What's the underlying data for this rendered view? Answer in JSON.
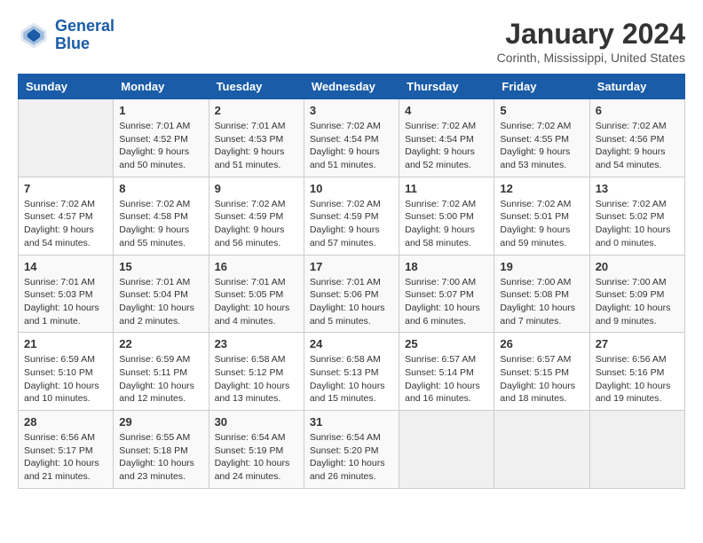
{
  "logo": {
    "line1": "General",
    "line2": "Blue"
  },
  "title": "January 2024",
  "location": "Corinth, Mississippi, United States",
  "days_of_week": [
    "Sunday",
    "Monday",
    "Tuesday",
    "Wednesday",
    "Thursday",
    "Friday",
    "Saturday"
  ],
  "weeks": [
    [
      {
        "num": "",
        "sunrise": "",
        "sunset": "",
        "daylight": "",
        "empty": true
      },
      {
        "num": "1",
        "sunrise": "Sunrise: 7:01 AM",
        "sunset": "Sunset: 4:52 PM",
        "daylight": "Daylight: 9 hours and 50 minutes."
      },
      {
        "num": "2",
        "sunrise": "Sunrise: 7:01 AM",
        "sunset": "Sunset: 4:53 PM",
        "daylight": "Daylight: 9 hours and 51 minutes."
      },
      {
        "num": "3",
        "sunrise": "Sunrise: 7:02 AM",
        "sunset": "Sunset: 4:54 PM",
        "daylight": "Daylight: 9 hours and 51 minutes."
      },
      {
        "num": "4",
        "sunrise": "Sunrise: 7:02 AM",
        "sunset": "Sunset: 4:54 PM",
        "daylight": "Daylight: 9 hours and 52 minutes."
      },
      {
        "num": "5",
        "sunrise": "Sunrise: 7:02 AM",
        "sunset": "Sunset: 4:55 PM",
        "daylight": "Daylight: 9 hours and 53 minutes."
      },
      {
        "num": "6",
        "sunrise": "Sunrise: 7:02 AM",
        "sunset": "Sunset: 4:56 PM",
        "daylight": "Daylight: 9 hours and 54 minutes."
      }
    ],
    [
      {
        "num": "7",
        "sunrise": "Sunrise: 7:02 AM",
        "sunset": "Sunset: 4:57 PM",
        "daylight": "Daylight: 9 hours and 54 minutes."
      },
      {
        "num": "8",
        "sunrise": "Sunrise: 7:02 AM",
        "sunset": "Sunset: 4:58 PM",
        "daylight": "Daylight: 9 hours and 55 minutes."
      },
      {
        "num": "9",
        "sunrise": "Sunrise: 7:02 AM",
        "sunset": "Sunset: 4:59 PM",
        "daylight": "Daylight: 9 hours and 56 minutes."
      },
      {
        "num": "10",
        "sunrise": "Sunrise: 7:02 AM",
        "sunset": "Sunset: 4:59 PM",
        "daylight": "Daylight: 9 hours and 57 minutes."
      },
      {
        "num": "11",
        "sunrise": "Sunrise: 7:02 AM",
        "sunset": "Sunset: 5:00 PM",
        "daylight": "Daylight: 9 hours and 58 minutes."
      },
      {
        "num": "12",
        "sunrise": "Sunrise: 7:02 AM",
        "sunset": "Sunset: 5:01 PM",
        "daylight": "Daylight: 9 hours and 59 minutes."
      },
      {
        "num": "13",
        "sunrise": "Sunrise: 7:02 AM",
        "sunset": "Sunset: 5:02 PM",
        "daylight": "Daylight: 10 hours and 0 minutes."
      }
    ],
    [
      {
        "num": "14",
        "sunrise": "Sunrise: 7:01 AM",
        "sunset": "Sunset: 5:03 PM",
        "daylight": "Daylight: 10 hours and 1 minute."
      },
      {
        "num": "15",
        "sunrise": "Sunrise: 7:01 AM",
        "sunset": "Sunset: 5:04 PM",
        "daylight": "Daylight: 10 hours and 2 minutes."
      },
      {
        "num": "16",
        "sunrise": "Sunrise: 7:01 AM",
        "sunset": "Sunset: 5:05 PM",
        "daylight": "Daylight: 10 hours and 4 minutes."
      },
      {
        "num": "17",
        "sunrise": "Sunrise: 7:01 AM",
        "sunset": "Sunset: 5:06 PM",
        "daylight": "Daylight: 10 hours and 5 minutes."
      },
      {
        "num": "18",
        "sunrise": "Sunrise: 7:00 AM",
        "sunset": "Sunset: 5:07 PM",
        "daylight": "Daylight: 10 hours and 6 minutes."
      },
      {
        "num": "19",
        "sunrise": "Sunrise: 7:00 AM",
        "sunset": "Sunset: 5:08 PM",
        "daylight": "Daylight: 10 hours and 7 minutes."
      },
      {
        "num": "20",
        "sunrise": "Sunrise: 7:00 AM",
        "sunset": "Sunset: 5:09 PM",
        "daylight": "Daylight: 10 hours and 9 minutes."
      }
    ],
    [
      {
        "num": "21",
        "sunrise": "Sunrise: 6:59 AM",
        "sunset": "Sunset: 5:10 PM",
        "daylight": "Daylight: 10 hours and 10 minutes."
      },
      {
        "num": "22",
        "sunrise": "Sunrise: 6:59 AM",
        "sunset": "Sunset: 5:11 PM",
        "daylight": "Daylight: 10 hours and 12 minutes."
      },
      {
        "num": "23",
        "sunrise": "Sunrise: 6:58 AM",
        "sunset": "Sunset: 5:12 PM",
        "daylight": "Daylight: 10 hours and 13 minutes."
      },
      {
        "num": "24",
        "sunrise": "Sunrise: 6:58 AM",
        "sunset": "Sunset: 5:13 PM",
        "daylight": "Daylight: 10 hours and 15 minutes."
      },
      {
        "num": "25",
        "sunrise": "Sunrise: 6:57 AM",
        "sunset": "Sunset: 5:14 PM",
        "daylight": "Daylight: 10 hours and 16 minutes."
      },
      {
        "num": "26",
        "sunrise": "Sunrise: 6:57 AM",
        "sunset": "Sunset: 5:15 PM",
        "daylight": "Daylight: 10 hours and 18 minutes."
      },
      {
        "num": "27",
        "sunrise": "Sunrise: 6:56 AM",
        "sunset": "Sunset: 5:16 PM",
        "daylight": "Daylight: 10 hours and 19 minutes."
      }
    ],
    [
      {
        "num": "28",
        "sunrise": "Sunrise: 6:56 AM",
        "sunset": "Sunset: 5:17 PM",
        "daylight": "Daylight: 10 hours and 21 minutes."
      },
      {
        "num": "29",
        "sunrise": "Sunrise: 6:55 AM",
        "sunset": "Sunset: 5:18 PM",
        "daylight": "Daylight: 10 hours and 23 minutes."
      },
      {
        "num": "30",
        "sunrise": "Sunrise: 6:54 AM",
        "sunset": "Sunset: 5:19 PM",
        "daylight": "Daylight: 10 hours and 24 minutes."
      },
      {
        "num": "31",
        "sunrise": "Sunrise: 6:54 AM",
        "sunset": "Sunset: 5:20 PM",
        "daylight": "Daylight: 10 hours and 26 minutes."
      },
      {
        "num": "",
        "sunrise": "",
        "sunset": "",
        "daylight": "",
        "empty": true
      },
      {
        "num": "",
        "sunrise": "",
        "sunset": "",
        "daylight": "",
        "empty": true
      },
      {
        "num": "",
        "sunrise": "",
        "sunset": "",
        "daylight": "",
        "empty": true
      }
    ]
  ]
}
